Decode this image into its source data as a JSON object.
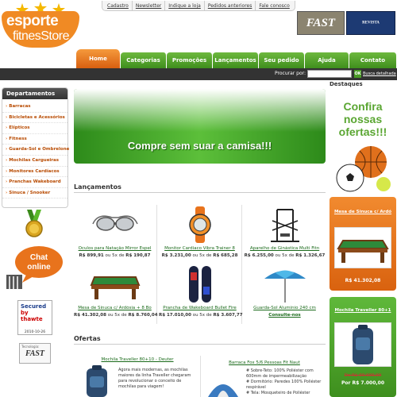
{
  "header": {
    "logo_line1": "esporte",
    "logo_line2": "fitnesStore",
    "top_links": [
      "Cadastro",
      "Newsletter",
      "Indique a loja",
      "Pedidos anteriores",
      "Fale conosco"
    ],
    "partner1": "FAST",
    "partner2_prefix": "REVISTA",
    "partner2": "EXAME"
  },
  "nav": {
    "tabs": [
      "Home",
      "Categorias",
      "Promoções",
      "Lançamentos",
      "Seu pedido",
      "Ajuda",
      "Contato"
    ],
    "active": "Home"
  },
  "search": {
    "label": "Procurar por:",
    "value": "",
    "button": "OK",
    "advanced": "Busca detalhada"
  },
  "sidebar": {
    "title": "Departamentos",
    "items": [
      "Barracas",
      "Bicicletas e Acessórios",
      "Elípticos",
      "Fitness",
      "Guarda-Sol e Ombrelone",
      "Mochilas Cargueiras",
      "Monitores Cardíacos",
      "Pranchas Wakeboard",
      "Sinuca / Snooker"
    ],
    "chat_line1": "Chat",
    "chat_line2": "online",
    "secured_line1": "Secured",
    "secured_line2": "by",
    "secured_brand": "thawte",
    "secured_date": "2010-10-26",
    "tech_label": "Tecnologia:",
    "tech_brand": "FAST"
  },
  "main": {
    "banner_text": "Compre sem suar a camisa!!!",
    "lancamentos_title": "Lançamentos",
    "products": [
      {
        "name": "Óculos para Natação Mirror Espel",
        "price": "R$ 899,91",
        "installments": " ou 5x de ",
        "installment_value": "R$ 190,87",
        "icon": "goggles-icon"
      },
      {
        "name": "Monitor Cardíaco Vibra Trainer 8",
        "price": "R$ 3.231,00",
        "installments": " ou 5x de ",
        "installment_value": "R$ 685,28",
        "icon": "watch-icon"
      },
      {
        "name": "Aparelho de Ginástica Multi Fitn",
        "price": "R$ 6.255,00",
        "installments": " ou 5x de ",
        "installment_value": "R$ 1.326,67",
        "icon": "gym-machine-icon"
      },
      {
        "name": "Mesa de Sinuca c/ Ardósia + 8 Bo",
        "price": "R$ 41.302,08",
        "installments": " ou 5x de ",
        "installment_value": "R$ 8.760,04",
        "icon": "pool-table-icon"
      },
      {
        "name": "Prancha de Wakeboard Bullet Fire",
        "price": "R$ 17.010,00",
        "installments": " ou 5x de ",
        "installment_value": "R$ 3.607,77",
        "icon": "wakeboard-icon"
      },
      {
        "name": "Guarda-Sol Alumínio 240 cm",
        "price": "Consulte-nos",
        "installments": "",
        "installment_value": "",
        "icon": "umbrella-icon"
      }
    ],
    "ofertas_title": "Ofertas",
    "offers": [
      {
        "name": "Mochila Traveller 80+10 - Deuter",
        "desc1": "Agora mais modernas, as mochilas",
        "desc2": "maiores da linha Traveller chegaram",
        "desc3": "para revolucionar o conceito de",
        "desc4": "mochilas para viagem!"
      },
      {
        "name": "Barraca Fox 5/6 Pessoas Fit Naut",
        "desc1": "# Sobre-Teto: 100% Poliéster com",
        "desc2": "600mm de impermeabilização",
        "desc3": "# Dormitório: Paredes 100% Poliéster",
        "desc4": "respirável",
        "desc5": "# Tela: Mosqueteiro de Poliéster"
      }
    ]
  },
  "right": {
    "title": "Destaques",
    "confira": [
      "Confira",
      "nossas",
      "ofertas!!!"
    ],
    "featured1": {
      "name": "Mesa de Sinuca c/ Ardó",
      "price": "R$ 41.302,08"
    },
    "featured2": {
      "name": "Mochila Traveller 80+1",
      "old_price": "De R$ 00.000,00",
      "price": "Por R$ 7.000,00"
    }
  },
  "colors": {
    "green": "#4a9b26",
    "orange": "#e8731c",
    "dark": "#333333"
  }
}
